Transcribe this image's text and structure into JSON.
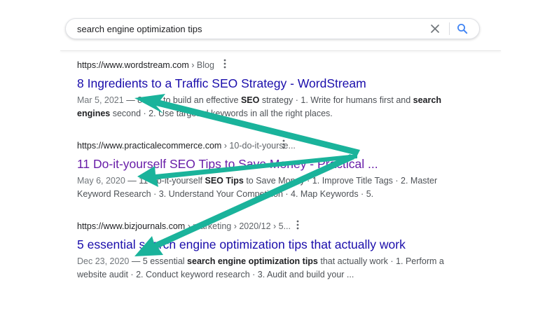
{
  "search": {
    "query": "search engine optimization tips",
    "clear_label": "×"
  },
  "results": [
    {
      "url": "https://www.wordstream.com",
      "breadcrumb": " › Blog",
      "title": "8 Ingredients to a Traffic SEO Strategy - WordStream",
      "title_state": "link",
      "snippet_line1": [
        {
          "t": "Mar 5, 2021",
          "s": "date"
        },
        {
          "t": " — 8 Tips to build an effective ",
          "s": ""
        },
        {
          "t": "SEO",
          "s": "bold"
        },
        {
          "t": " strategy · 1. Write for humans first and ",
          "s": ""
        },
        {
          "t": "search",
          "s": "bold"
        }
      ],
      "snippet_line2": [
        {
          "t": "engines",
          "s": "bold"
        },
        {
          "t": " second · 2. Use targeted keywords in all the right places.",
          "s": ""
        }
      ]
    },
    {
      "url": "https://www.practicalecommerce.com",
      "breadcrumb": " › 10-do-it-yourse...",
      "title": "11 Do-it-yourself SEO Tips to Save Money - Practical ...",
      "title_state": "visited",
      "snippet_line1": [
        {
          "t": "May 6, 2020",
          "s": "date"
        },
        {
          "t": " — 11 Do-it-yourself ",
          "s": ""
        },
        {
          "t": "SEO Tips",
          "s": "bold"
        },
        {
          "t": " to Save Money · 1. Improve Title Tags · 2. Master",
          "s": ""
        }
      ],
      "snippet_line2": [
        {
          "t": "Keyword Research · 3. Understand Your Competition · 4. Map Keywords · 5.",
          "s": ""
        }
      ]
    },
    {
      "url": "https://www.bizjournals.com",
      "breadcrumb": " › marketing › 2020/12 › 5...",
      "title": "5 essential search engine optimization tips that actually work",
      "title_state": "link",
      "snippet_line1": [
        {
          "t": "Dec 23, 2020",
          "s": "date"
        },
        {
          "t": " — 5 essential ",
          "s": ""
        },
        {
          "t": "search engine optimization tips",
          "s": "bold"
        },
        {
          "t": " that actually work · 1. Perform a",
          "s": ""
        }
      ],
      "snippet_line2": [
        {
          "t": "website audit · 2. Conduct keyword research · 3. Audit and build your ...",
          "s": ""
        }
      ]
    }
  ],
  "colors": {
    "link": "#1a0dab",
    "visited": "#681da8",
    "arrow": "#1ab39b"
  },
  "icons": {
    "clear": "close-icon",
    "search": "magnifier-icon",
    "more": "vertical-dots-icon"
  }
}
